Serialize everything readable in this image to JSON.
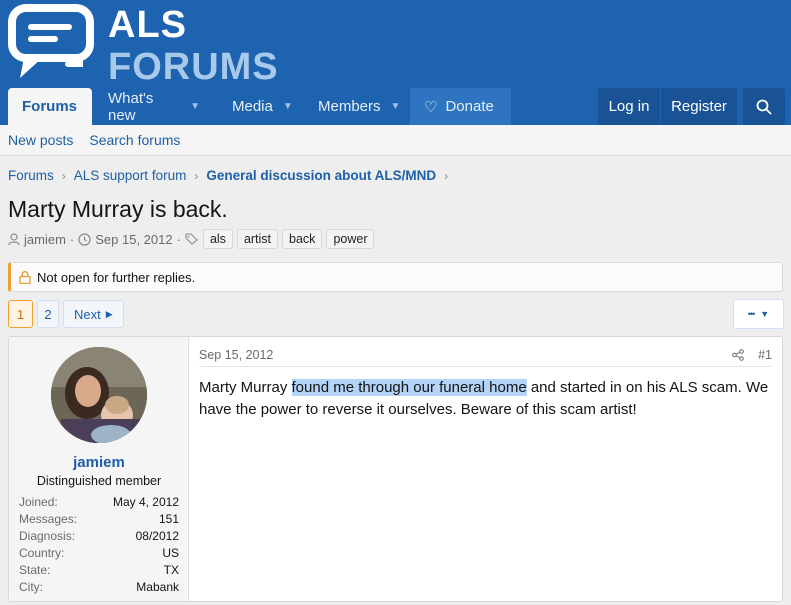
{
  "header": {
    "logo_line1": "ALS",
    "logo_line2": "FORUMS"
  },
  "nav": {
    "tabs": [
      {
        "label": "Forums"
      },
      {
        "label": "What's new"
      },
      {
        "label": "Media"
      },
      {
        "label": "Members"
      },
      {
        "label": "Donate"
      }
    ],
    "login": "Log in",
    "register": "Register"
  },
  "subnav": {
    "items": [
      "New posts",
      "Search forums"
    ]
  },
  "breadcrumb": [
    "Forums",
    "ALS support forum",
    "General discussion about ALS/MND"
  ],
  "thread": {
    "title": "Marty Murray is back.",
    "author": "jamiem",
    "date": "Sep 15, 2012",
    "tags": [
      "als",
      "artist",
      "back",
      "power"
    ],
    "notice": "Not open for further replies."
  },
  "pager": {
    "pages": [
      "1",
      "2"
    ],
    "next": "Next",
    "more": "•••"
  },
  "post": {
    "username": "jamiem",
    "user_title": "Distinguished member",
    "stats": [
      {
        "k": "Joined:",
        "v": "May 4, 2012"
      },
      {
        "k": "Messages:",
        "v": "151"
      },
      {
        "k": "Diagnosis:",
        "v": "08/2012"
      },
      {
        "k": "Country:",
        "v": "US"
      },
      {
        "k": "State:",
        "v": "TX"
      },
      {
        "k": "City:",
        "v": "Mabank"
      }
    ],
    "date": "Sep 15, 2012",
    "number": "#1",
    "text_before": "Marty Murray ",
    "text_highlight": "found me through our funeral home",
    "text_after": " and started in on his ALS scam. We have the power to reverse it ourselves. Beware of this scam artist!"
  }
}
